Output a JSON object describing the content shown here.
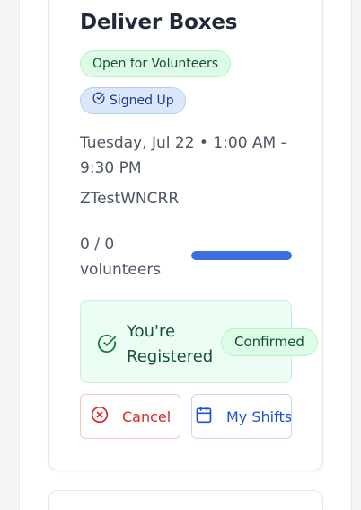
{
  "shift": {
    "title": "Deliver Boxes",
    "status_badge": "Open for Volunteers",
    "signed_up_badge": "Signed Up",
    "datetime": "Tuesday, Jul 22 • 1:00 AM - 9:30 PM",
    "location": "ZTestWNCRR",
    "volunteer_count": "0 / 0 volunteers",
    "progress_fraction": 1.0
  },
  "registration": {
    "message": "You're Registered",
    "status": "Confirmed"
  },
  "actions": {
    "cancel_label": "Cancel",
    "my_shifts_label": "My Shifts"
  },
  "colors": {
    "accent_blue": "#3b6fe0",
    "success_green": "#14532d",
    "danger_red": "#dc2626"
  },
  "icons": {
    "signed_up": "check-circle-icon",
    "registered": "check-circle-icon",
    "cancel": "x-circle-icon",
    "my_shifts": "calendar-icon"
  }
}
